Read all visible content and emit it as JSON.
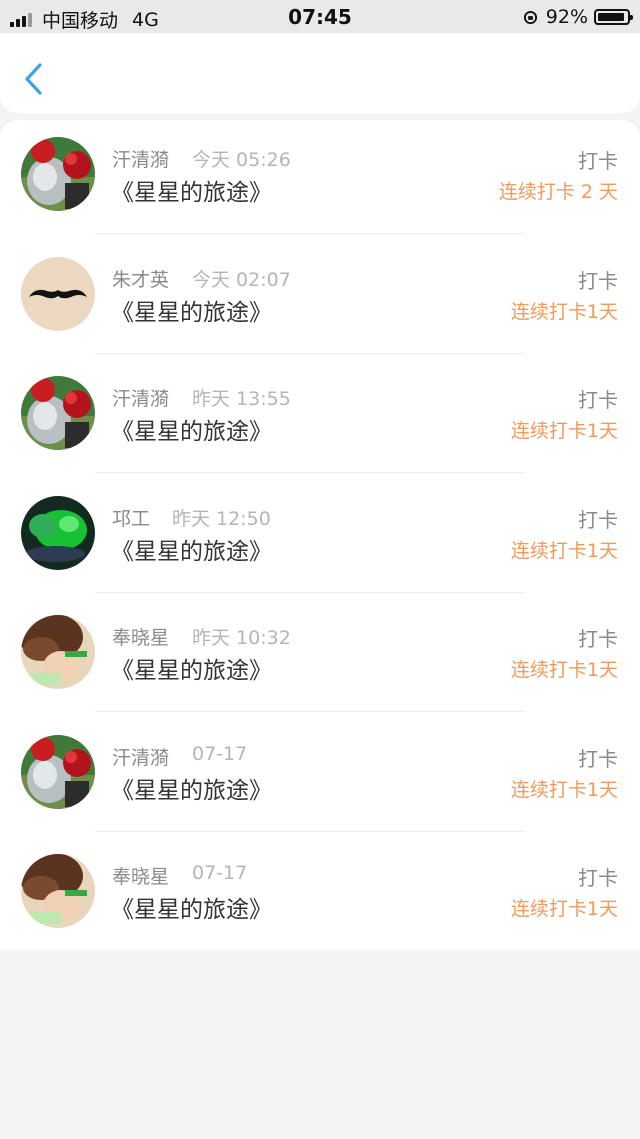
{
  "status_bar": {
    "carrier": "中国移动",
    "network": "4G",
    "time": "07:45",
    "battery": "92%",
    "battery_level": 0.92
  },
  "header": {
    "back_icon": "chevron-left-icon",
    "accent_color": "#3aa3e0"
  },
  "colors": {
    "streak": "#f29a5c",
    "name": "#8a8a8a",
    "time": "#b5b5b5"
  },
  "records": [
    {
      "name": "汗清漪",
      "time": "今天 05:26",
      "title": "《星星的旅途》",
      "action": "打卡",
      "streak": "连续打卡 2 天",
      "avatar": "red-flower-avatar"
    },
    {
      "name": "朱才英",
      "time": "今天 02:07",
      "title": "《星星的旅途》",
      "action": "打卡",
      "streak": "连续打卡1天",
      "avatar": "mustache-avatar"
    },
    {
      "name": "汗清漪",
      "time": "昨天 13:55",
      "title": "《星星的旅途》",
      "action": "打卡",
      "streak": "连续打卡1天",
      "avatar": "red-flower-avatar"
    },
    {
      "name": "邛工",
      "time": "昨天 12:50",
      "title": "《星星的旅途》",
      "action": "打卡",
      "streak": "连续打卡1天",
      "avatar": "green-jade-avatar"
    },
    {
      "name": "奉晓星",
      "time": "昨天 10:32",
      "title": "《星星的旅途》",
      "action": "打卡",
      "streak": "连续打卡1天",
      "avatar": "girl-photo-avatar"
    },
    {
      "name": "汗清漪",
      "time": "07-17",
      "title": "《星星的旅途》",
      "action": "打卡",
      "streak": "连续打卡1天",
      "avatar": "red-flower-avatar"
    },
    {
      "name": "奉晓星",
      "time": "07-17",
      "title": "《星星的旅途》",
      "action": "打卡",
      "streak": "连续打卡1天",
      "avatar": "girl-photo-avatar"
    }
  ]
}
